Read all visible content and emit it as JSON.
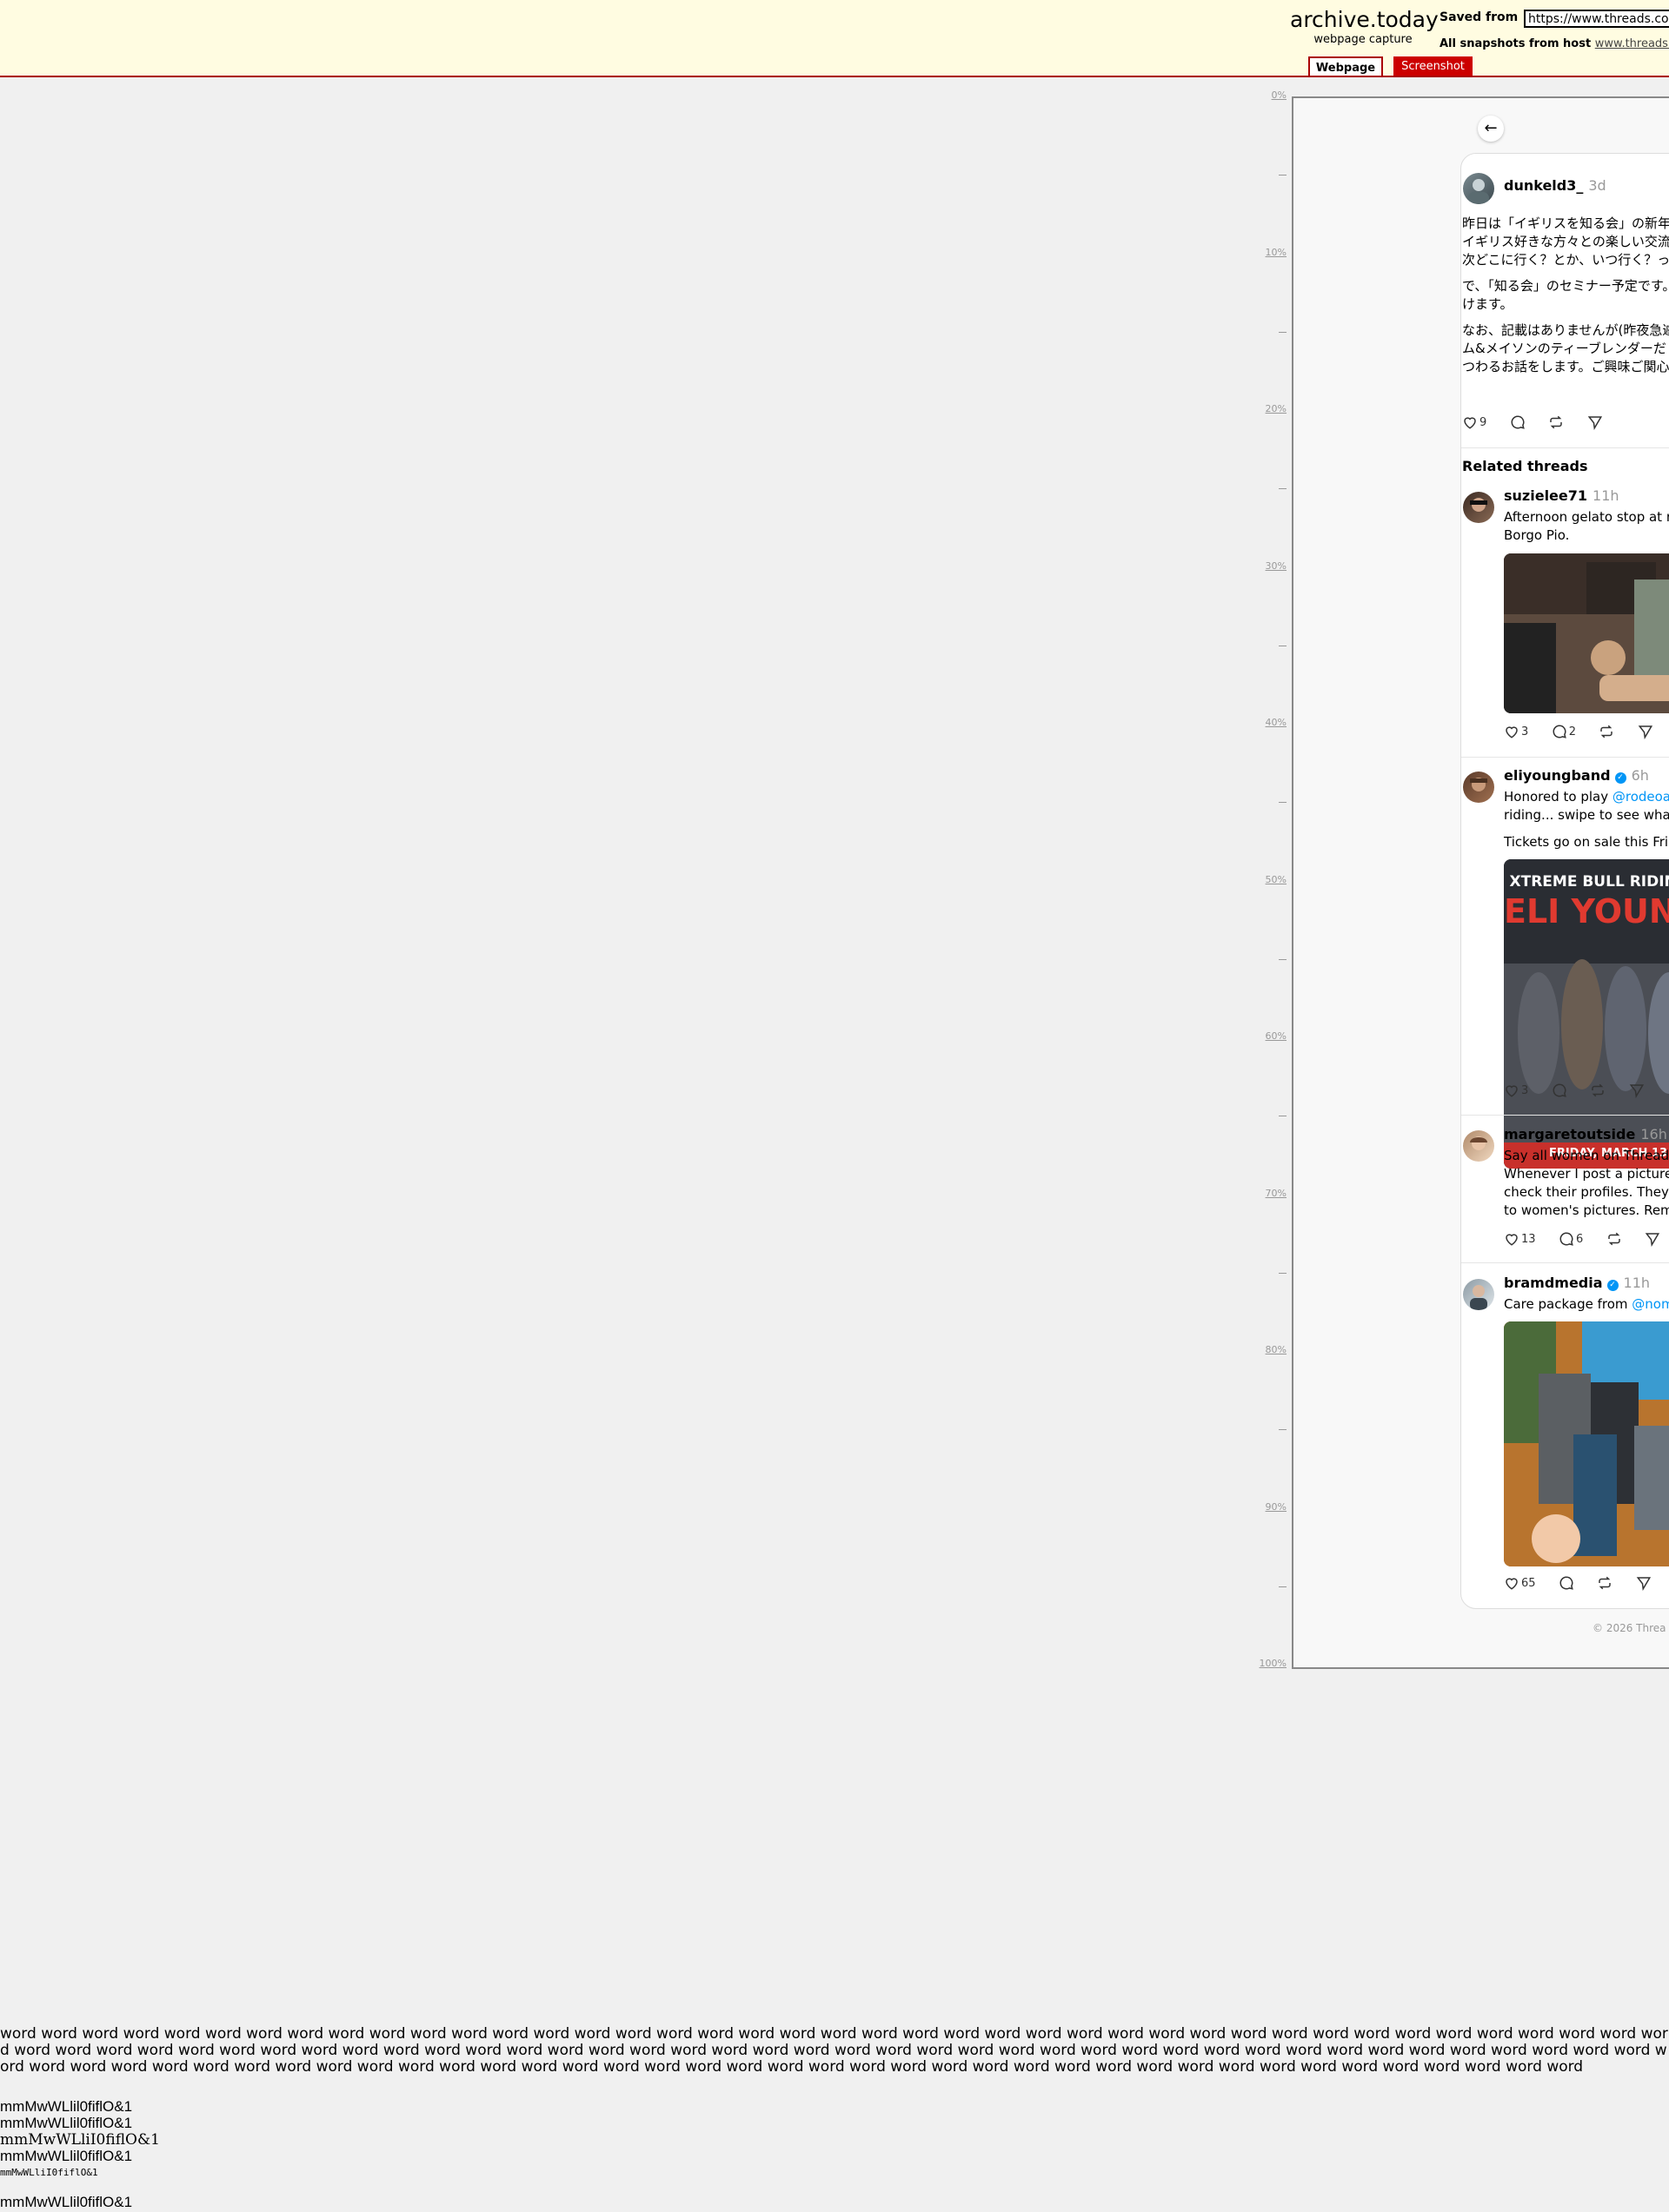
{
  "archive": {
    "title": "archive.today",
    "subtitle": "webpage capture",
    "saved_from_label": "Saved from",
    "saved_from_url": "https://www.threads.com",
    "snapshots_label": "All snapshots",
    "snapshots_from": "from host",
    "snapshots_host": "www.threads.co",
    "tabs": {
      "webpage": "Webpage",
      "screenshot": "Screenshot"
    }
  },
  "ruler": [
    "0%",
    "10%",
    "20%",
    "30%",
    "40%",
    "50%",
    "60%",
    "70%",
    "80%",
    "90%",
    "100%"
  ],
  "post": {
    "handle": "dunkeld3_",
    "time": "3d",
    "lines": [
      "昨日は「イギリスを知る会」の新年",
      "イギリス好きな方々との楽しい交流",
      "次どこに行く？とか、いつ行く？っ",
      "で、「知る会」のセミナー予定です。",
      "けます。",
      "なお、記載はありませんが(昨夜急遽",
      "ム&メイソンのティーブレンダーだ",
      "つわるお話をします。ご興味ご関心"
    ],
    "likes": "9"
  },
  "related": {
    "title": "Related threads",
    "items": [
      {
        "handle": "suzielee71",
        "time": "11h",
        "lines": [
          "Afternoon gelato stop at r",
          "Borgo Pio."
        ],
        "likes": "3",
        "replies": "2",
        "media_alt": "gelato shop photo"
      },
      {
        "handle": "eliyoungband",
        "time": "6h",
        "verified": true,
        "line1_prefix": "Honored to play ",
        "line1_mention": "@rodeoa",
        "lines": [
          "riding... swipe to see wha",
          "Tickets go on sale this Fri"
        ],
        "likes": "3",
        "poster": {
          "top": "XTREME BULL RIDING &",
          "main": "ELI YOUNG BA",
          "bottom": "FRIDAY, MARCH 13"
        }
      },
      {
        "handle": "margaretoutside",
        "time": "16h",
        "lines": [
          "Say all women on Thread",
          "Whenever I post a picture",
          "check their profiles. They",
          "to women's pictures. Rem"
        ],
        "likes": "13",
        "replies": "6"
      },
      {
        "handle": "bramdmedia",
        "time": "11h",
        "verified": true,
        "line1_prefix": "Care package from ",
        "line1_mention": "@nom",
        "likes": "65",
        "media_alt": "care package photo"
      }
    ]
  },
  "footer": "© 2026 Threa",
  "filler": {
    "paragraph": "word word word word word word word word word word word word word word word word word word word word word word word word word word word word word word word word word word word word word word word word word word word word word word word word word word word word word word word word word word word word word word word word word word word word word word word word word word word word word word word word word word word word word word word word word word word word word word word word word word word word word word word word word word word word word word word word word word word word word word word word",
    "glyph_line": "mmMwWLlil0fiflO&1",
    "glyph_line_serif": "mmMwWLliI0fiflO&1",
    "glyph_line_mono": "mmMwWLliI0fiflO&1"
  },
  "colors": {
    "header_bg": "#fffce1",
    "accent": "#aa0000",
    "link_blue": "#0095f6"
  }
}
